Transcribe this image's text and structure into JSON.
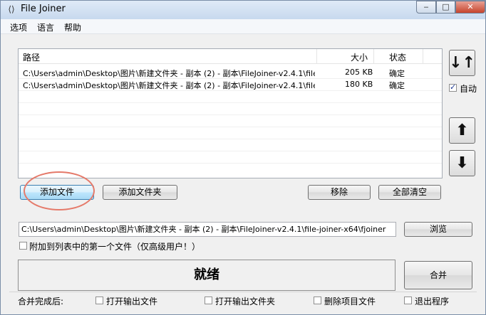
{
  "window": {
    "title": "File Joiner",
    "app_icon": "joiner-icon",
    "controls": {
      "minimize": "‒",
      "maximize": "□",
      "close": "✕"
    }
  },
  "menu": {
    "items": [
      "选项",
      "语言",
      "帮助"
    ]
  },
  "list": {
    "columns": {
      "path": "路径",
      "size": "大小",
      "status": "状态"
    },
    "rows": [
      {
        "path": "C:\\Users\\admin\\Desktop\\图片\\新建文件夹 - 副本 (2) - 副本\\FileJoiner-v2.4.1\\file...",
        "size": "205 KB",
        "status": "确定"
      },
      {
        "path": "C:\\Users\\admin\\Desktop\\图片\\新建文件夹 - 副本 (2) - 副本\\FileJoiner-v2.4.1\\file...",
        "size": "180 KB",
        "status": "确定"
      }
    ]
  },
  "side": {
    "sort_icon": "sort-updown-icon",
    "auto_label": "自动",
    "auto_checked": true,
    "up_icon": "arrow-up-icon",
    "down_icon": "arrow-down-icon"
  },
  "buttons": {
    "add_file": "添加文件",
    "add_folder": "添加文件夹",
    "remove": "移除",
    "clear_all": "全部清空",
    "browse": "浏览",
    "merge": "合并"
  },
  "output": {
    "path": "C:\\Users\\admin\\Desktop\\图片\\新建文件夹 - 副本 (2) - 副本\\FileJoiner-v2.4.1\\file-joiner-x64\\fjoiner",
    "append_label": "附加到列表中的第一个文件（仅高级用户！）",
    "append_checked": false
  },
  "status": {
    "text": "就绪"
  },
  "after_merge": {
    "label": "合并完成后:",
    "options": [
      {
        "label": "打开输出文件",
        "checked": false
      },
      {
        "label": "打开输出文件夹",
        "checked": false
      },
      {
        "label": "删除项目文件",
        "checked": false
      },
      {
        "label": "退出程序",
        "checked": false
      }
    ]
  },
  "colors": {
    "annotation": "#e57a6a",
    "focus_border": "#3c7fb1"
  }
}
